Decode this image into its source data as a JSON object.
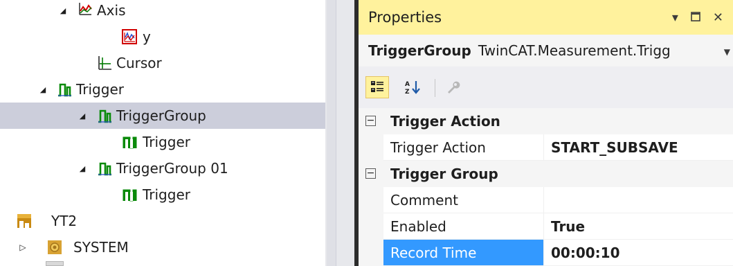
{
  "tree": {
    "items": [
      {
        "label": "Axis",
        "icon": "axis-chart-icon"
      },
      {
        "label": "y",
        "icon": "y-axis-chart-icon"
      },
      {
        "label": "Cursor",
        "icon": "cursor-chart-icon"
      },
      {
        "label": "Trigger",
        "icon": "trigger-pulse-icon"
      },
      {
        "label": "TriggerGroup",
        "icon": "trigger-pulse-icon"
      },
      {
        "label": "Trigger",
        "icon": "trigger-pulse-icon"
      },
      {
        "label": "TriggerGroup 01",
        "icon": "trigger-pulse-icon"
      },
      {
        "label": "Trigger",
        "icon": "trigger-pulse-icon"
      },
      {
        "label": "YT2",
        "icon": "yt-project-icon"
      },
      {
        "label": "SYSTEM",
        "icon": "system-gear-icon"
      }
    ]
  },
  "properties": {
    "title": "Properties",
    "object_name": "TriggerGroup",
    "object_type": "TwinCAT.Measurement.Trigg",
    "categories": [
      {
        "title": "Trigger Action",
        "rows": [
          {
            "name": "Trigger Action",
            "value": "START_SUBSAVE"
          }
        ]
      },
      {
        "title": "Trigger Group",
        "rows": [
          {
            "name": "Comment",
            "value": ""
          },
          {
            "name": "Enabled",
            "value": "True"
          },
          {
            "name": "Record Time",
            "value": "00:00:10"
          }
        ]
      }
    ],
    "selected_property": "Record Time"
  },
  "colors": {
    "accent_title": "#fff29d",
    "selection_blue": "#3399ff",
    "tree_selection": "#cccedb",
    "trigger_green": "#009900"
  }
}
